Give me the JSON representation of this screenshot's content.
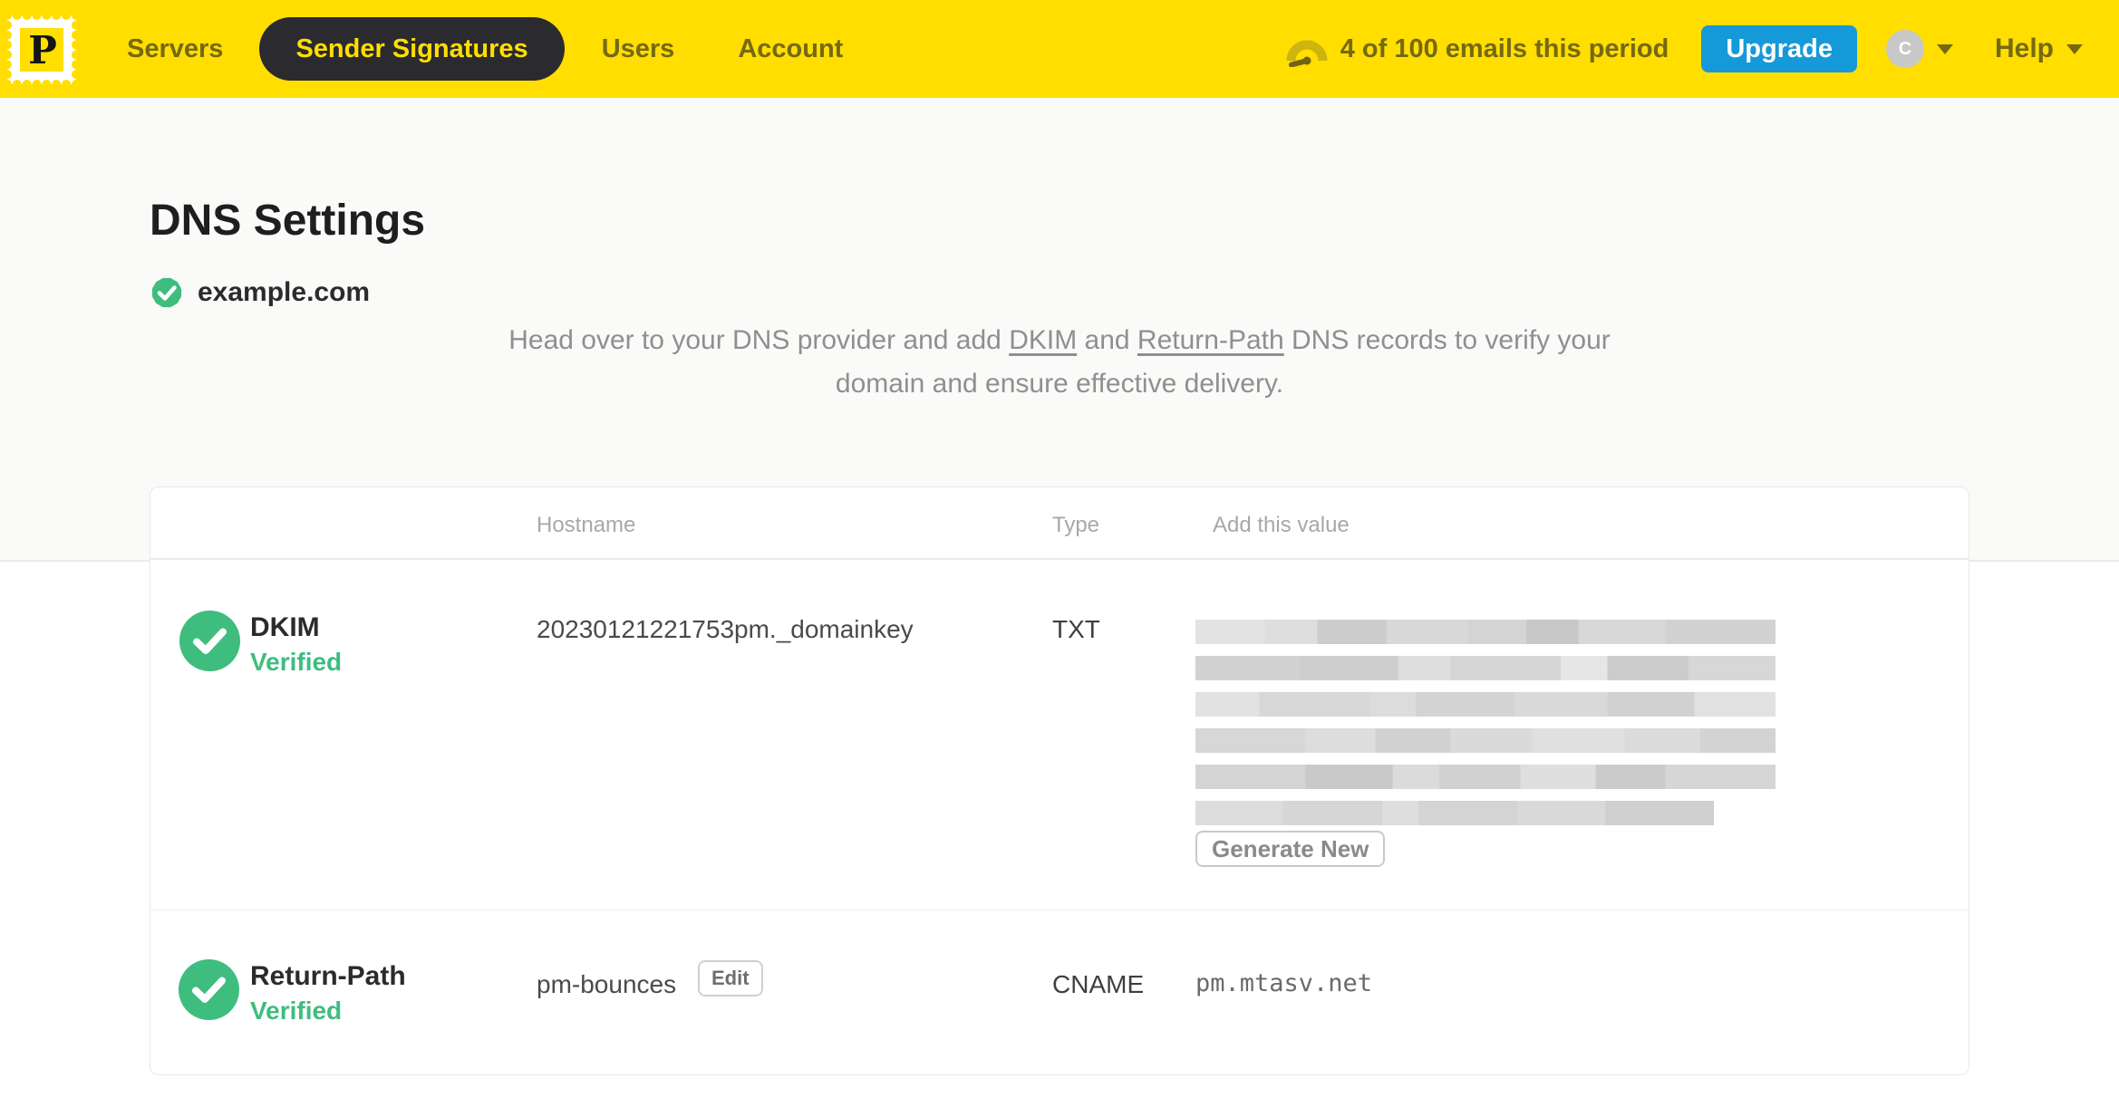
{
  "colors": {
    "brand-yellow": "#FFDE00",
    "nav-text": "#75690f",
    "nav-pill-bg": "#2b2a2e",
    "upgrade-blue": "#1699d8",
    "verified-green": "#3ebd7e"
  },
  "nav": {
    "logo_letter": "P",
    "items": [
      {
        "label": "Servers"
      },
      {
        "label": "Sender Signatures"
      },
      {
        "label": "Users"
      },
      {
        "label": "Account"
      }
    ],
    "active_item": "Sender Signatures",
    "usage_text": "4 of 100 emails this period",
    "upgrade_label": "Upgrade",
    "avatar_initial": "C",
    "help_label": "Help"
  },
  "page": {
    "title": "DNS Settings",
    "domain": "example.com",
    "intro": {
      "part1": "Head over to your DNS provider and add ",
      "link1": "DKIM",
      "part2": " and ",
      "link2": "Return-Path",
      "part3": " DNS records to verify your domain and ensure effective delivery."
    }
  },
  "table": {
    "headers": {
      "hostname": "Hostname",
      "type": "Type",
      "value": "Add this value"
    },
    "rows": [
      {
        "name": "DKIM",
        "status": "Verified",
        "hostname": "20230121221753pm._domainkey",
        "type": "TXT",
        "value_style": "redacted",
        "redacted_lines": 6,
        "action_label": "Generate New"
      },
      {
        "name": "Return-Path",
        "status": "Verified",
        "hostname": "pm-bounces",
        "edit_label": "Edit",
        "type": "CNAME",
        "value": "pm.mtasv.net"
      }
    ]
  }
}
